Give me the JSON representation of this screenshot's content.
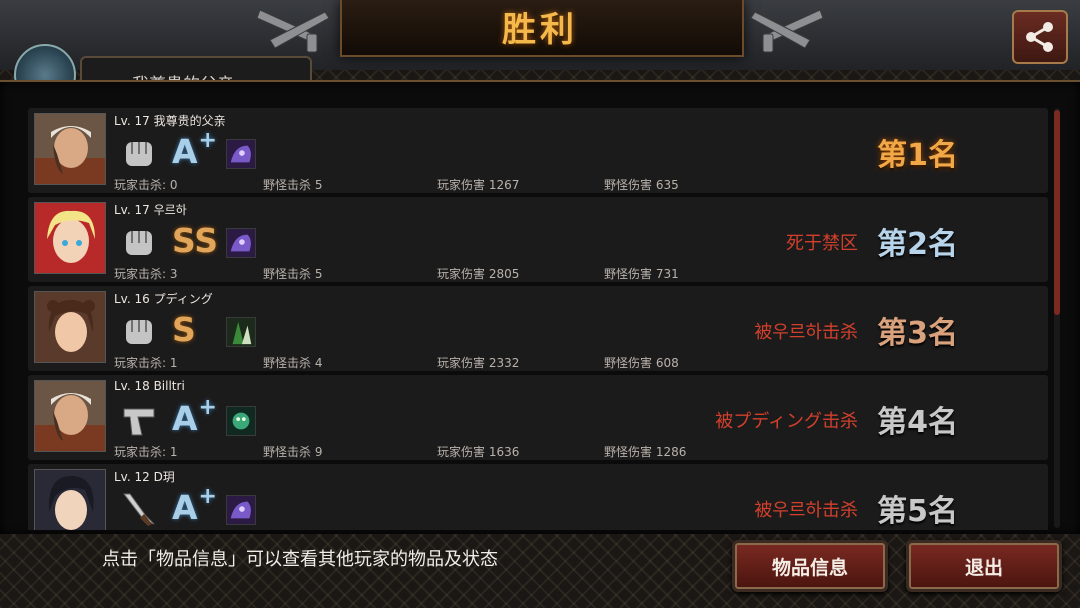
{
  "title": "胜利",
  "header": {
    "current_player_name": "我尊贵的父亲"
  },
  "hint": "点击「物品信息」可以查看其他玩家的物品及状态",
  "buttons": {
    "items": "物品信息",
    "exit": "退出"
  },
  "stat_labels": {
    "player_kills": "玩家击杀",
    "monster_kills": "野怪击杀",
    "player_damage": "玩家伤害",
    "monster_damage": "野怪伤害"
  },
  "players": [
    {
      "level_name": "Lv. 17  我尊贵的父亲",
      "weapon_icon": "fist-icon",
      "grade": "A",
      "grade_plus": "+",
      "grade_class": "a",
      "skill_icon": "purple-beast-skill-icon",
      "player_kills": "玩家击杀: 0",
      "monster_kills": "野怪击杀  5",
      "player_damage": "玩家伤害  1267",
      "monster_damage": "野怪伤害  635",
      "status": "",
      "rank": "第1名"
    },
    {
      "level_name": "Lv. 17  우르하",
      "weapon_icon": "fist-icon",
      "grade": "SS",
      "grade_plus": "",
      "grade_class": "ss",
      "skill_icon": "purple-beast-skill-icon",
      "player_kills": "玩家击杀: 3",
      "monster_kills": "野怪击杀  5",
      "player_damage": "玩家伤害  2805",
      "monster_damage": "野怪伤害  731",
      "status": "死于禁区",
      "rank": "第2名"
    },
    {
      "level_name": "Lv. 16  プディング",
      "weapon_icon": "fist-icon",
      "grade": "S",
      "grade_plus": "",
      "grade_class": "s",
      "skill_icon": "green-fighter-skill-icon",
      "player_kills": "玩家击杀: 1",
      "monster_kills": "野怪击杀  4",
      "player_damage": "玩家伤害  2332",
      "monster_damage": "野怪伤害  608",
      "status": "被우르하击杀",
      "rank": "第3名"
    },
    {
      "level_name": "Lv. 18  Billtri",
      "weapon_icon": "pistol-icon",
      "grade": "A",
      "grade_plus": "+",
      "grade_class": "a",
      "skill_icon": "green-creature-skill-icon",
      "player_kills": "玩家击杀: 1",
      "monster_kills": "野怪击杀  9",
      "player_damage": "玩家伤害  1636",
      "monster_damage": "野怪伤害  1286",
      "status": "被プディング击杀",
      "rank": "第4名"
    },
    {
      "level_name": "Lv. 12  D玥",
      "weapon_icon": "knife-icon",
      "grade": "A",
      "grade_plus": "+",
      "grade_class": "a",
      "skill_icon": "purple-beast-skill-icon",
      "player_kills": "",
      "monster_kills": "",
      "player_damage": "",
      "monster_damage": "",
      "status": "被우르하击杀",
      "rank": "第5名"
    }
  ],
  "colors": {
    "rank_first": "#f0a848",
    "status_red": "#d2402c",
    "button_red": "#7a2a22"
  }
}
